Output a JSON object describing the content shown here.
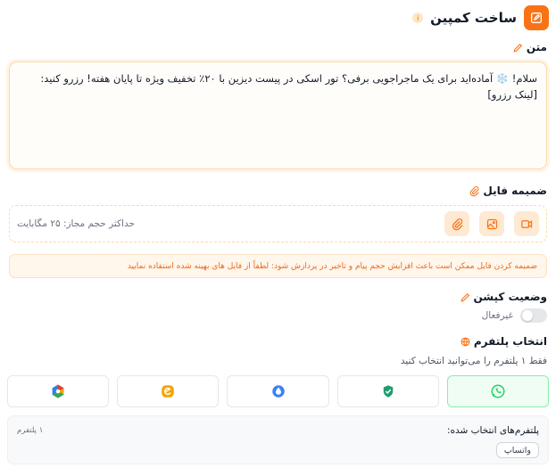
{
  "header": {
    "title": "ساخت کمپین",
    "info_glyph": "i"
  },
  "text_section": {
    "label": "متن",
    "value": "سلام! ❄️ آماده‌اید برای یک ماجراجویی برفی؟ تور اسکی در پیست دیزین با ۲۰٪ تخفیف ویژه تا پایان هفته! رزرو کنید: [لینک رزرو]"
  },
  "attachment": {
    "label": "ضمیمه فایل",
    "max_size": "حداکثر حجم مجاز: ۲۵ مگابایت",
    "buttons": [
      "video-icon",
      "image-icon",
      "paperclip-icon"
    ],
    "warning": "ضمیمه کردن فایل ممکن است باعث افزایش حجم پیام و تاخیر در پردازش شود: لطفاً از فایل های بهینه شده استفاده نمایید"
  },
  "caption_status": {
    "label": "وضعیت کپشن",
    "state_text": "غیرفعال",
    "enabled": false
  },
  "platform_select": {
    "label": "انتخاب پلتفرم",
    "hint": "فقط ۱ پلتفرم را می‌توانید انتخاب کنید",
    "platforms": [
      {
        "icon": "whatsapp-icon",
        "selected": true,
        "color": "#25D366"
      },
      {
        "icon": "shield-check-icon",
        "selected": false,
        "color": "#1E9E6E"
      },
      {
        "icon": "messenger-drop-icon",
        "selected": false,
        "color": "#3B82F6"
      },
      {
        "icon": "eitaa-icon",
        "selected": false,
        "color": "#F5A300"
      },
      {
        "icon": "hex-logo-icon",
        "selected": false,
        "color": "#E53935"
      }
    ]
  },
  "selected_platforms": {
    "title": "پلتفرم‌های انتخاب شده:",
    "count": "۱ پلتفرم",
    "chips": [
      "واتساپ"
    ]
  },
  "colors": {
    "accent": "#F97316",
    "border_warm": "#FCD9A8",
    "warning_text": "#EA6A1A"
  }
}
